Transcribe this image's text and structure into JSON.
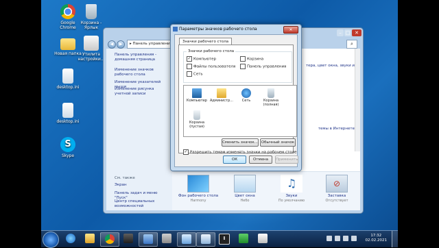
{
  "desktop_icons": [
    {
      "id": "chrome",
      "label": "Google\nChrome",
      "icon": "chrome-icon"
    },
    {
      "id": "bin",
      "label": "Корзина -\nЯрлык",
      "icon": "recycle-bin-icon"
    },
    {
      "id": "folder",
      "label": "Новая папка",
      "icon": "folder-icon"
    },
    {
      "id": "wifi",
      "label": "Утилита\nнастройки...",
      "icon": "wifi-utility-icon"
    },
    {
      "id": "ini1",
      "label": "desktop.ini",
      "icon": "settings-file-icon"
    },
    {
      "id": "ini2",
      "label": "desktop.ini",
      "icon": "settings-file-icon"
    },
    {
      "id": "skype",
      "label": "Skype",
      "icon": "skype-icon"
    }
  ],
  "control_panel": {
    "address": "▸ Панель управления ▸",
    "left_links": [
      "Панель управления - домашняя страница",
      "Изменение значков рабочего стола",
      "Изменение указателей мыши",
      "Изменение рисунка учетной записи"
    ],
    "see_also": "См. также",
    "see_also_links": [
      "Экран",
      "Панель задач и меню \"Пуск\"",
      "Центр специальных возможностей"
    ],
    "main_text_1": "тера, цвет окна, звуки и",
    "main_text_2": "темы в Интернете",
    "theme_items": [
      {
        "label": "Фон рабочего стола",
        "sub": "Harmony",
        "icon": "wallpaper-icon"
      },
      {
        "label": "Цвет окна",
        "sub": "Небо",
        "icon": "window-color-icon"
      },
      {
        "label": "Звуки",
        "sub": "По умолчанию",
        "icon": "sounds-icon"
      },
      {
        "label": "Заставка",
        "sub": "Отсутствует",
        "icon": "screensaver-icon"
      }
    ]
  },
  "dialog": {
    "title": "Параметры значков рабочего стола",
    "tab": "Значки рабочего стола",
    "group_label": "Значки рабочего стола",
    "checkboxes": [
      {
        "label": "Компьютер",
        "checked": true
      },
      {
        "label": "Корзина",
        "checked": false
      },
      {
        "label": "Файлы пользователя",
        "checked": false
      },
      {
        "label": "Панель управления",
        "checked": false
      },
      {
        "label": "Сеть",
        "checked": false
      }
    ],
    "icons": [
      {
        "label": "Компьютер",
        "icon": "computer-icon"
      },
      {
        "label": "Администр...",
        "icon": "user-folder-icon"
      },
      {
        "label": "Сеть",
        "icon": "network-icon"
      },
      {
        "label": "Корзина (полная)",
        "icon": "recycle-bin-full-icon"
      },
      {
        "label": "Корзина (пустая)",
        "icon": "recycle-bin-empty-icon"
      }
    ],
    "change_icon_btn": "Сменить значок...",
    "default_icon_btn": "Обычный значок",
    "allow_themes": "Разрешить темам изменять значки на рабочем столе",
    "allow_themes_checked": true,
    "ok": "ОК",
    "cancel": "Отмена",
    "apply": "Применить"
  },
  "taskbar": {
    "time": "17:32",
    "date": "02.02.2021"
  }
}
